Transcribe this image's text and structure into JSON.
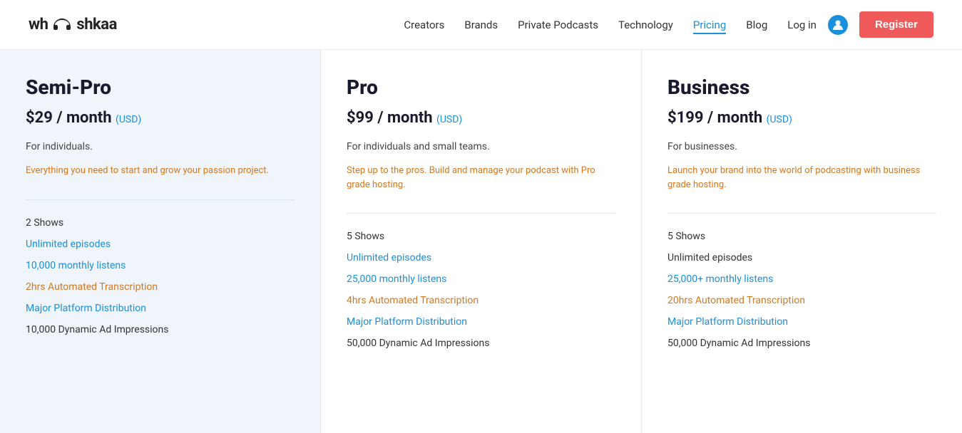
{
  "header": {
    "logo": "whooshkaa",
    "nav": [
      {
        "label": "Creators",
        "active": false
      },
      {
        "label": "Brands",
        "active": false
      },
      {
        "label": "Private Podcasts",
        "active": false
      },
      {
        "label": "Technology",
        "active": false
      },
      {
        "label": "Pricing",
        "active": true
      },
      {
        "label": "Blog",
        "active": false
      }
    ],
    "login_label": "Log in",
    "register_label": "Register"
  },
  "plans": [
    {
      "name": "Semi-Pro",
      "price": "$29",
      "period": "/ month",
      "currency_note": "(USD)",
      "audience": "For individuals.",
      "tagline": "Everything you need to start and grow your passion project.",
      "features": [
        {
          "text": "2 Shows",
          "style": "normal"
        },
        {
          "text": "Unlimited episodes",
          "style": "highlight"
        },
        {
          "text": "10,000 monthly listens",
          "style": "highlight"
        },
        {
          "text": "2hrs Automated Transcription",
          "style": "highlight-orange"
        },
        {
          "text": "Major Platform Distribution",
          "style": "highlight"
        },
        {
          "text": "10,000 Dynamic Ad Impressions",
          "style": "normal"
        }
      ]
    },
    {
      "name": "Pro",
      "price": "$99",
      "period": "/ month",
      "currency_note": "(USD)",
      "audience": "For individuals and small teams.",
      "tagline": "Step up to the pros. Build and manage your podcast with Pro grade hosting.",
      "features": [
        {
          "text": "5 Shows",
          "style": "normal"
        },
        {
          "text": "Unlimited episodes",
          "style": "highlight"
        },
        {
          "text": "25,000 monthly listens",
          "style": "highlight"
        },
        {
          "text": "4hrs Automated Transcription",
          "style": "highlight-orange"
        },
        {
          "text": "Major Platform Distribution",
          "style": "highlight"
        },
        {
          "text": "50,000 Dynamic Ad Impressions",
          "style": "normal"
        }
      ]
    },
    {
      "name": "Business",
      "price": "$199",
      "period": "/ month",
      "currency_note": "(USD)",
      "audience": "For businesses.",
      "tagline": "Launch your brand into the world of podcasting with business grade hosting.",
      "features": [
        {
          "text": "5 Shows",
          "style": "normal"
        },
        {
          "text": "Unlimited episodes",
          "style": "normal"
        },
        {
          "text": "25,000+ monthly listens",
          "style": "highlight"
        },
        {
          "text": "20hrs Automated Transcription",
          "style": "highlight-orange"
        },
        {
          "text": "Major Platform Distribution",
          "style": "highlight"
        },
        {
          "text": "50,000 Dynamic Ad Impressions",
          "style": "normal"
        }
      ]
    }
  ]
}
